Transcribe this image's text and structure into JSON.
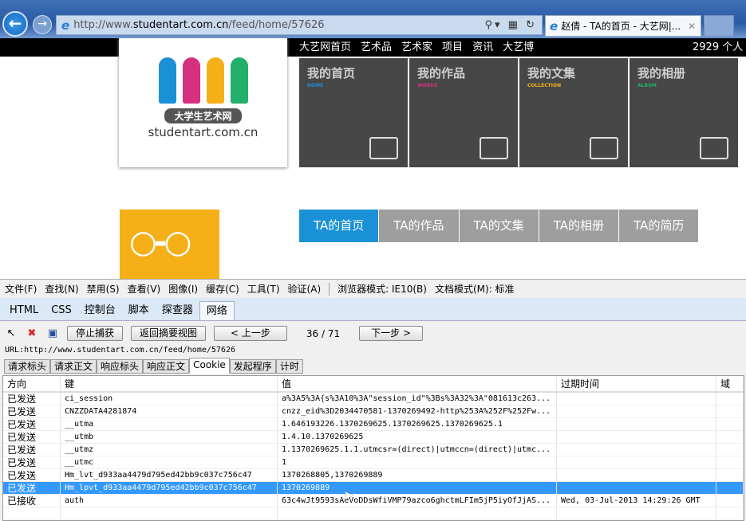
{
  "browser": {
    "url_prefix": "http://www.",
    "url_domain": "studentart.com.cn",
    "url_path": "/feed/home/57626",
    "tab_title": "赵倩 - TA的首页 - 大艺网|...",
    "addr_tools": "⚲▾ ▦ ↻"
  },
  "site": {
    "topnav": [
      "大艺网首页",
      "艺术品",
      "艺术家",
      "项目",
      "资讯",
      "大艺博"
    ],
    "count": "2929 个人",
    "logo_cn": "大学生艺术网",
    "logo_en": "studentart.com.cn",
    "tiles": [
      {
        "title": "我的首页",
        "sub": "HOME",
        "color": "#1a91d6"
      },
      {
        "title": "我的作品",
        "sub": "WORKS",
        "color": "#d6307f"
      },
      {
        "title": "我的文集",
        "sub": "COLLECTION",
        "color": "#f5b018"
      },
      {
        "title": "我的相册",
        "sub": "ALBUM",
        "color": "#22b06a"
      }
    ],
    "subtabs": [
      "TA的首页",
      "TA的作品",
      "TA的文集",
      "TA的相册",
      "TA的简历"
    ]
  },
  "devtools": {
    "menu": [
      "文件(F)",
      "查找(N)",
      "禁用(S)",
      "查看(V)",
      "图像(I)",
      "缓存(C)",
      "工具(T)",
      "验证(A)"
    ],
    "mode": [
      "浏览器模式: IE10(B)",
      "文档模式(M): 标准"
    ],
    "tabs": [
      "HTML",
      "CSS",
      "控制台",
      "脚本",
      "探查器",
      "网络"
    ],
    "buttons": {
      "stop": "停止捕获",
      "back": "返回摘要视图",
      "prev": "< 上一步",
      "next": "下一步 >"
    },
    "counter": "36 / 71",
    "url": "URL:http://www.studentart.com.cn/feed/home/57626",
    "subtabs": [
      "请求标头",
      "请求正文",
      "响应标头",
      "响应正文",
      "Cookie",
      "发起程序",
      "计时"
    ],
    "columns": [
      "方向",
      "键",
      "值",
      "过期时间",
      "域"
    ],
    "rows": [
      [
        "已发送",
        "ci_session",
        "a%3A5%3A{s%3A10%3A\"session_id\"%3Bs%3A32%3A\"081613c263...",
        ""
      ],
      [
        "已发送",
        "CNZZDATA4281874",
        "cnzz_eid%3D2034470581-1370269492-http%253A%252F%252Fw...",
        ""
      ],
      [
        "已发送",
        "__utma",
        "1.646193226.1370269625.1370269625.1370269625.1",
        ""
      ],
      [
        "已发送",
        "__utmb",
        "1.4.10.1370269625",
        ""
      ],
      [
        "已发送",
        "__utmz",
        "1.1370269625.1.1.utmcsr=(direct)|utmccn=(direct)|utmc...",
        ""
      ],
      [
        "已发送",
        "__utmc",
        "1",
        ""
      ],
      [
        "已发送",
        "Hm_lvt_d933aa4479d795ed42bb9c037c756c47",
        "1370268805,1370269889",
        ""
      ],
      [
        "已发送",
        "Hm_lpvt_d933aa4479d795ed42bb9c037c756c47",
        "1370269889",
        ""
      ],
      [
        "已接收",
        "auth",
        "63c4wJt9593sAeVoDDsWfiVMP79azco6ghctmLFIm5jP5iyOfJjAS...",
        "Wed, 03-Jul-2013 14:29:26 GMT"
      ]
    ],
    "selected_row": 7
  }
}
